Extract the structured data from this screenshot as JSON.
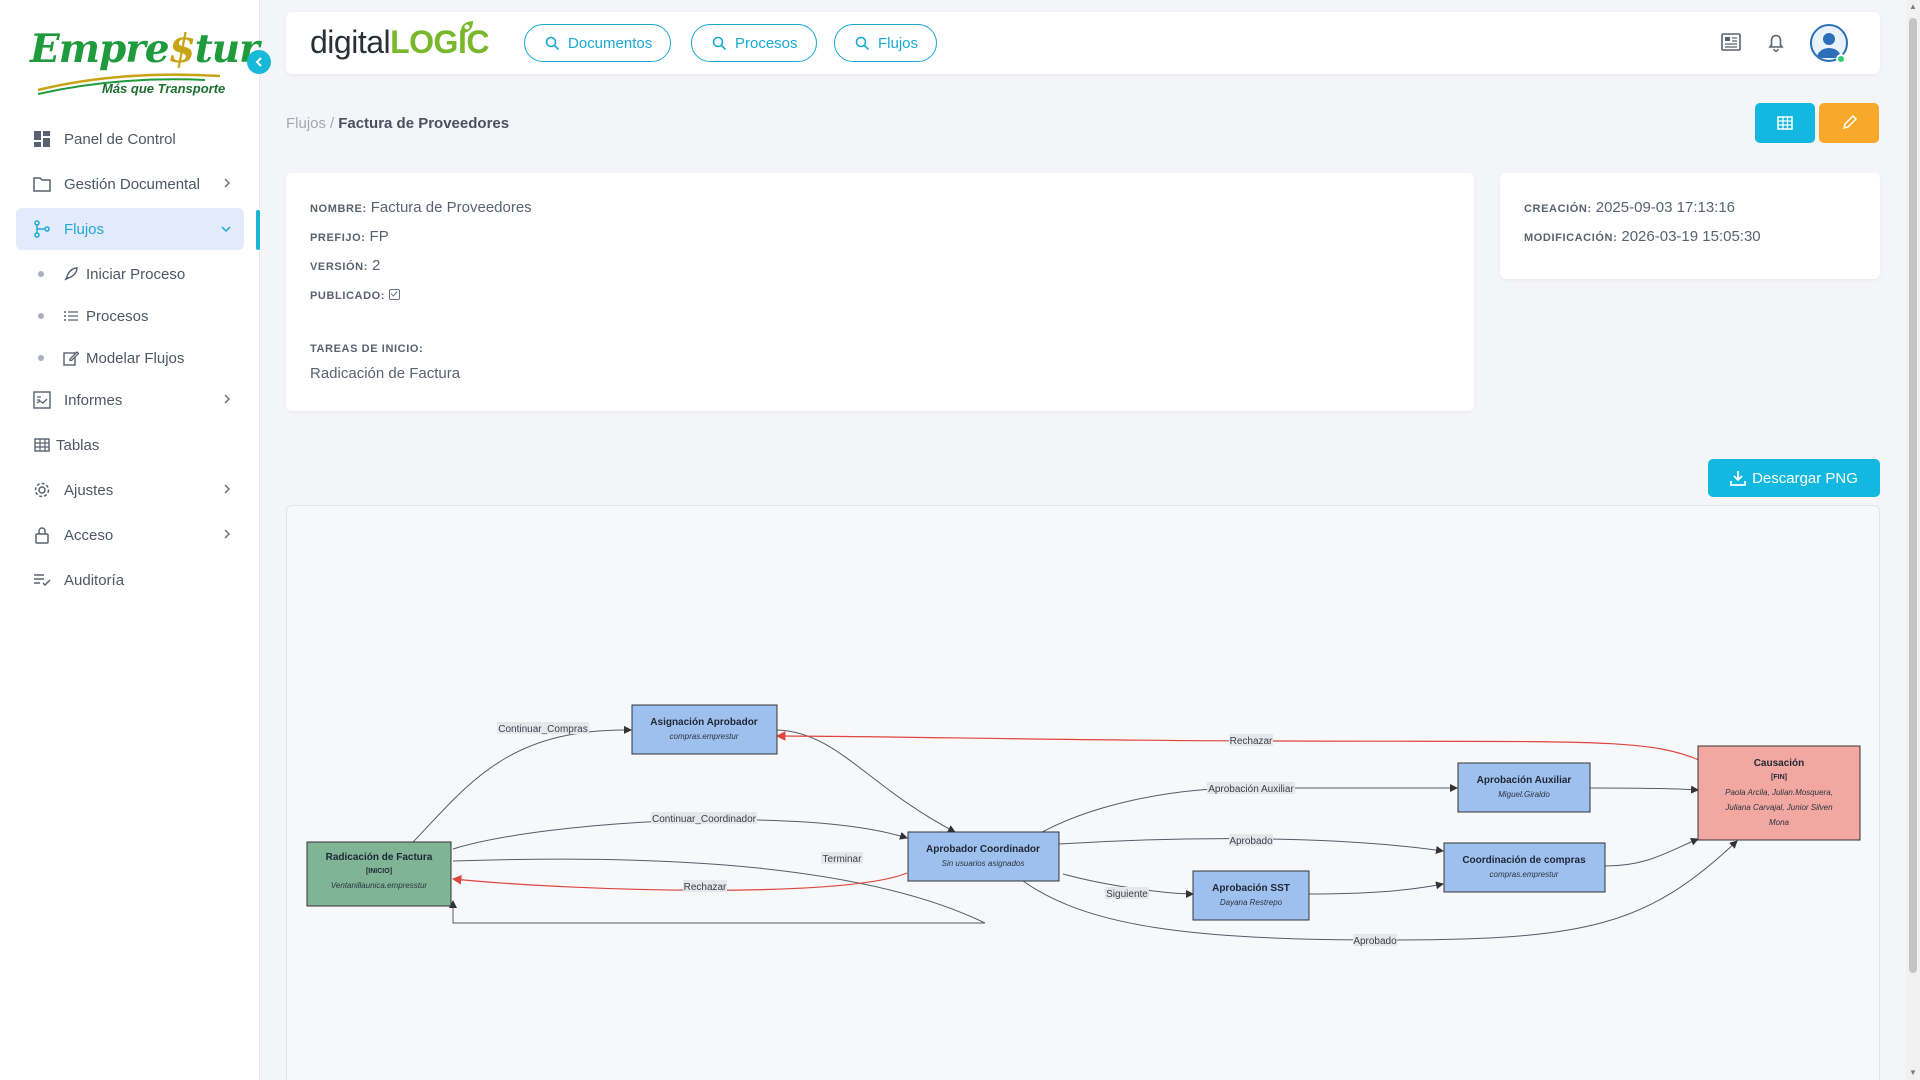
{
  "sidebar": {
    "logo_text": "Empre$tur",
    "logo_tagline": "Más que Transporte",
    "items": [
      {
        "label": "Panel de Control",
        "icon": "dashboard-icon"
      },
      {
        "label": "Gestión Documental",
        "icon": "folder-icon"
      },
      {
        "label": "Flujos",
        "icon": "flow-icon",
        "active": true
      },
      {
        "label": "Informes",
        "icon": "report-icon"
      },
      {
        "label": "Tablas",
        "icon": "table-icon"
      },
      {
        "label": "Ajustes",
        "icon": "gear-icon"
      },
      {
        "label": "Acceso",
        "icon": "lock-icon"
      },
      {
        "label": "Auditoría",
        "icon": "audit-icon"
      }
    ],
    "subitems": [
      {
        "label": "Iniciar Proceso",
        "icon": "rocket-icon"
      },
      {
        "label": "Procesos",
        "icon": "list-icon"
      },
      {
        "label": "Modelar Flujos",
        "icon": "edit-icon"
      }
    ]
  },
  "topbar": {
    "brand_digital": "digital",
    "brand_logic": "LOGIC",
    "search_buttons": [
      "Documentos",
      "Procesos",
      "Flujos"
    ]
  },
  "breadcrumb": {
    "parent": "Flujos",
    "separator": "/",
    "current": "Factura de Proveedores"
  },
  "info": {
    "nombre_label": "NOMBRE:",
    "nombre": "Factura de Proveedores",
    "prefijo_label": "PREFIJO:",
    "prefijo": "FP",
    "version_label": "VERSIÓN:",
    "version": "2",
    "publicado_label": "PUBLICADO:",
    "publicado": true,
    "tareas_label": "TAREAS DE INICIO:",
    "tareas": "Radicación de Factura"
  },
  "meta": {
    "creacion_label": "CREACIÓN:",
    "creacion": "2025-09-03 17:13:16",
    "modificacion_label": "MODIFICACIÓN:",
    "modificacion": "2026-03-19 15:05:30"
  },
  "download_label": "Descargar PNG",
  "diagram": {
    "nodes": [
      {
        "id": "radicacion",
        "title": "Radicación de Factura",
        "tag": "[INICIO]",
        "sub": "Ventanillaunica.empresstur"
      },
      {
        "id": "asignacion",
        "title": "Asignación Aprobador",
        "sub": "compras.emprestur"
      },
      {
        "id": "coordinador",
        "title": "Aprobador Coordinador",
        "sub": "Sin usuarios asignados"
      },
      {
        "id": "sst",
        "title": "Aprobación SST",
        "sub": "Dayana Restrepo"
      },
      {
        "id": "auxiliar",
        "title": "Aprobación Auxiliar",
        "sub": "Miguel.Giraldo"
      },
      {
        "id": "coord_compras",
        "title": "Coordinación de compras",
        "sub": "compras.emprestur"
      },
      {
        "id": "causacion",
        "title": "Causación",
        "tag": "[FIN]",
        "sub_lines": [
          "Paola Arcila, Julian.Mosquera,",
          "Juliana Carvajal, Junior Silven",
          "Mona"
        ]
      }
    ],
    "edge_labels": {
      "continuar_compras": "Continuar_Compras",
      "continuar_coordinador": "Continuar_Coordinador",
      "terminar": "Terminar",
      "rechazar_1": "Rechazar",
      "rechazar_2": "Rechazar",
      "aprobacion_auxiliar": "Aprobación Auxiliar",
      "aprobado_1": "Aprobado",
      "aprobado_2": "Aprobado",
      "siguiente": "Siguiente"
    },
    "colors": {
      "start": "#7fb595",
      "task": "#9ec0ef",
      "end": "#f2a8a0",
      "reject": "#e0463d",
      "edge": "#555b66"
    }
  }
}
